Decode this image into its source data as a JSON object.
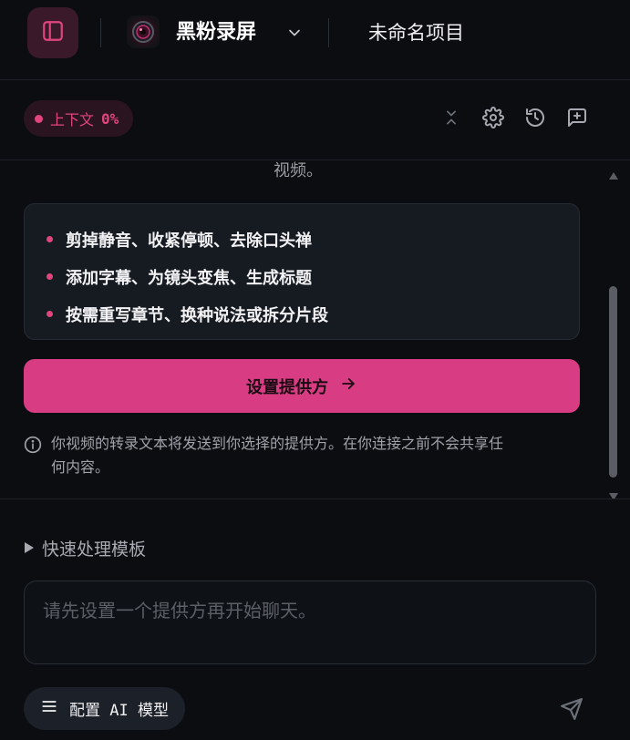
{
  "header": {
    "app_title": "黑粉录屏",
    "project_name": "未命名项目"
  },
  "toolbar": {
    "context_label": "上下文",
    "context_value": "0%"
  },
  "content": {
    "partial_text": "视频。",
    "features": [
      "剪掉静音、收紧停顿、去除口头禅",
      "添加字幕、为镜头变焦、生成标题",
      "按需重写章节、换种说法或拆分片段"
    ],
    "setup_button": "设置提供方",
    "notice_line1": "你视频的转录文本将发送到你选择的提供方。在你连接之前不会共享任",
    "notice_line2": "何内容。"
  },
  "bottom": {
    "templates_label": "快速处理模板",
    "chat_placeholder": "请先设置一个提供方再开始聊天。",
    "model_button": "配置 AI 模型"
  },
  "colors": {
    "accent": "#d83d84",
    "accent_text": "#e0457e",
    "background": "#0b0d11",
    "panel": "#161a21"
  },
  "icons": {
    "sidebar": "sidebar-toggle-icon",
    "app": "app-lens-icon",
    "chevron": "chevron-down-icon",
    "collapse": "collapse-icon",
    "settings": "gear-icon",
    "history": "history-icon",
    "new_chat": "new-chat-icon",
    "info": "info-icon",
    "arrow": "arrow-right-icon",
    "menu": "menu-icon",
    "send": "send-icon"
  }
}
